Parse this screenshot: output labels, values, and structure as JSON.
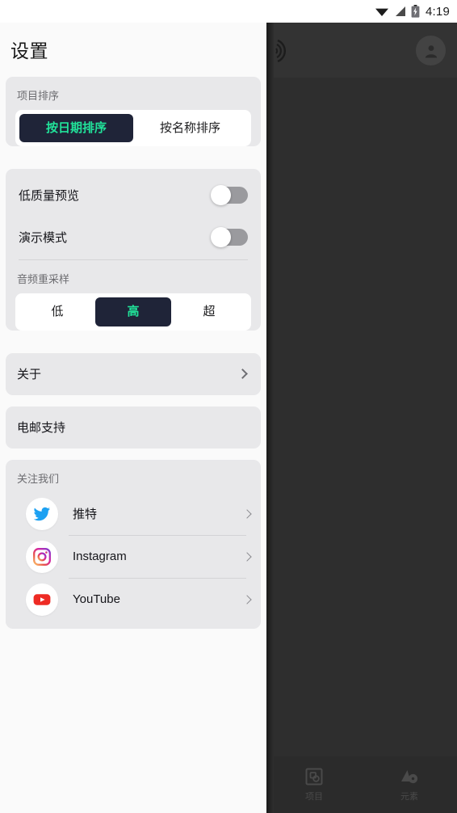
{
  "status_bar": {
    "time": "4:19",
    "icons": [
      "wifi-icon",
      "cell-signal-icon",
      "battery-charging-icon"
    ]
  },
  "drawer": {
    "title": "设置",
    "sort_group": {
      "label": "项目排序",
      "options": [
        {
          "label": "按日期排序",
          "selected": true
        },
        {
          "label": "按名称排序",
          "selected": false
        }
      ]
    },
    "preferences": {
      "toggles": [
        {
          "label": "低质量预览",
          "value": "off"
        },
        {
          "label": "演示模式",
          "value": "off"
        }
      ],
      "audio_group": {
        "label": "音频重采样",
        "options": [
          {
            "label": "低",
            "selected": false
          },
          {
            "label": "高",
            "selected": true
          },
          {
            "label": "超",
            "selected": false
          }
        ]
      }
    },
    "about_row": {
      "label": "关于",
      "icon": "chevron-right-icon"
    },
    "email_row": {
      "label": "电邮支持"
    },
    "follow_group": {
      "label": "关注我们",
      "items": [
        {
          "label": "推特",
          "icon": "twitter-icon"
        },
        {
          "label": "Instagram",
          "icon": "instagram-icon"
        },
        {
          "label": "YouTube",
          "icon": "youtube-icon"
        }
      ]
    }
  },
  "background_app": {
    "avatar": "account-avatar-icon",
    "logo": "sound-wave-logo-icon",
    "bottom_nav": [
      {
        "label": "项目",
        "icon": "projects-icon"
      },
      {
        "label": "元素",
        "icon": "elements-icon"
      }
    ]
  },
  "colors": {
    "accent_green": "#21e39a",
    "segment_dark": "#1f2438",
    "card_bg": "#e8e8ea",
    "drawer_bg": "#fafafa",
    "twitter_blue": "#1da1f2",
    "youtube_red": "#ee2b24"
  }
}
